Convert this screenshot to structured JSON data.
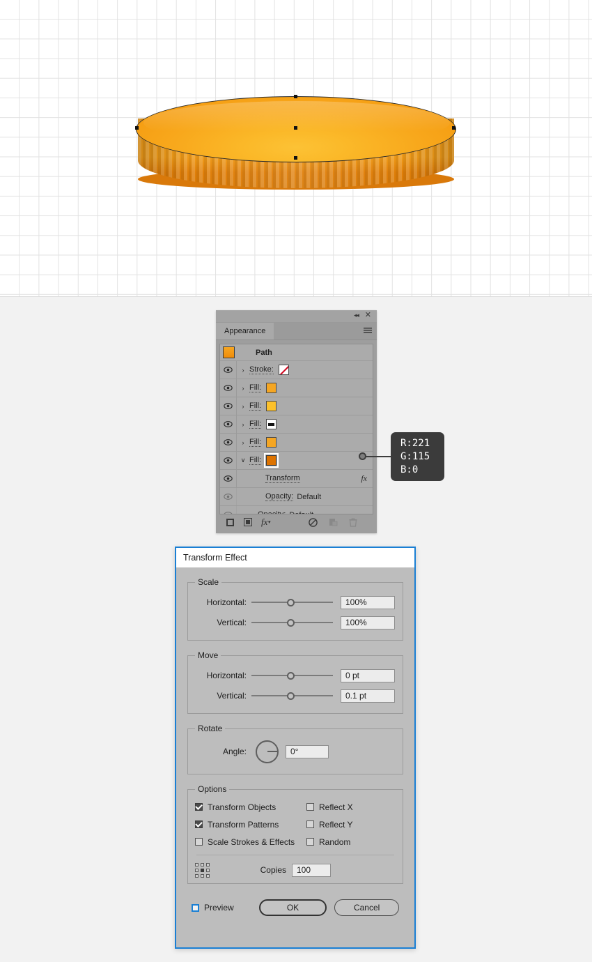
{
  "canvas": {
    "artwork_name": "coin-3d-illustration",
    "anchors": [
      "top-center",
      "left-center",
      "center",
      "bottom-center",
      "right-center"
    ]
  },
  "appearance_panel": {
    "tab_label": "Appearance",
    "collapse_icon": "double-chevron-left-icon",
    "close_icon": "close-icon",
    "menu_icon": "panel-menu-icon",
    "target_label": "Path",
    "rows": [
      {
        "label": "Stroke:",
        "swatch": "none",
        "arrow": "›",
        "visible": true
      },
      {
        "label": "Fill:",
        "swatch": "#f5a623",
        "arrow": "›",
        "visible": true
      },
      {
        "label": "Fill:",
        "swatch": "#fcc12b",
        "arrow": "›",
        "visible": true
      },
      {
        "label": "Fill:",
        "swatch": "gradient",
        "arrow": "›",
        "visible": true
      },
      {
        "label": "Fill:",
        "swatch": "#f5a623",
        "arrow": "›",
        "visible": true
      },
      {
        "label": "Fill:",
        "swatch": "#dd7300",
        "arrow": "∨",
        "visible": true,
        "selected": true
      }
    ],
    "sub_rows": [
      {
        "label": "Transform",
        "fx": "fx",
        "visible": true
      },
      {
        "label": "Opacity:",
        "value": "Default",
        "visible": false
      },
      {
        "label": "Opacity:",
        "value": "Default",
        "visible": false
      }
    ],
    "footer_icons": [
      "add-new-fill-icon",
      "add-new-stroke-icon",
      "add-new-effect-icon",
      "clear-appearance-icon",
      "duplicate-item-icon",
      "delete-item-icon"
    ]
  },
  "callout": {
    "r": "R:221",
    "g": "G:115",
    "b": "B:0"
  },
  "dialog": {
    "title": "Transform Effect",
    "scale": {
      "legend": "Scale",
      "horizontal_label": "Horizontal:",
      "horizontal_value": "100%",
      "vertical_label": "Vertical:",
      "vertical_value": "100%"
    },
    "move": {
      "legend": "Move",
      "horizontal_label": "Horizontal:",
      "horizontal_value": "0 pt",
      "vertical_label": "Vertical:",
      "vertical_value": "0.1 pt"
    },
    "rotate": {
      "legend": "Rotate",
      "angle_label": "Angle:",
      "angle_value": "0°"
    },
    "options": {
      "legend": "Options",
      "transform_objects": {
        "label": "Transform Objects",
        "checked": true
      },
      "transform_patterns": {
        "label": "Transform Patterns",
        "checked": true
      },
      "scale_strokes": {
        "label": "Scale Strokes & Effects",
        "checked": false
      },
      "reflect_x": {
        "label": "Reflect X",
        "checked": false
      },
      "reflect_y": {
        "label": "Reflect Y",
        "checked": false
      },
      "random": {
        "label": "Random",
        "checked": false
      },
      "copies_label": "Copies",
      "copies_value": "100",
      "anchor_icon": "nine-point-anchor-icon"
    },
    "footer": {
      "preview_label": "Preview",
      "preview_checked": false,
      "ok_label": "OK",
      "cancel_label": "Cancel"
    }
  }
}
